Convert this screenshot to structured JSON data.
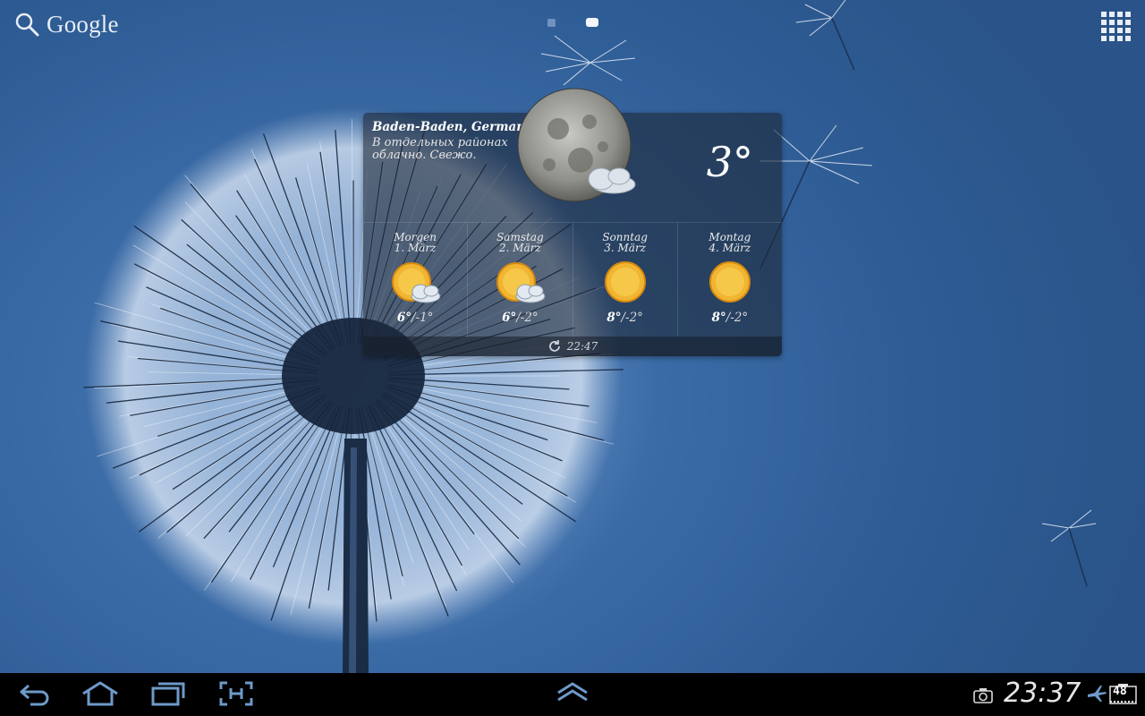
{
  "search": {
    "label": "Google"
  },
  "pages": {
    "count": 2,
    "active_index": 1
  },
  "weather": {
    "location": "Baden-Baden, Germany",
    "description": "В отдельных районах облачно. Свежо.",
    "temperature": "3°",
    "condition_icon": "moon-with-cloud-icon",
    "forecast": [
      {
        "day": "Morgen",
        "date": "1. März",
        "high": "6°",
        "low": "/-1°",
        "icon": "sun-with-cloud-icon"
      },
      {
        "day": "Samstag",
        "date": "2. März",
        "high": "6°",
        "low": "/-2°",
        "icon": "sun-with-cloud-icon"
      },
      {
        "day": "Sonntag",
        "date": "3. März",
        "high": "8°",
        "low": "/-2°",
        "icon": "sun-icon"
      },
      {
        "day": "Montag",
        "date": "4. März",
        "high": "8°",
        "low": "/-2°",
        "icon": "sun-icon"
      }
    ],
    "updated": "22:47"
  },
  "status": {
    "time": "23:37",
    "battery": "48",
    "airplane_mode": true
  },
  "colors": {
    "wallpaper": "#2d5a8f",
    "widget_bg": "#1e2a3a",
    "system_bar": "#000000"
  }
}
